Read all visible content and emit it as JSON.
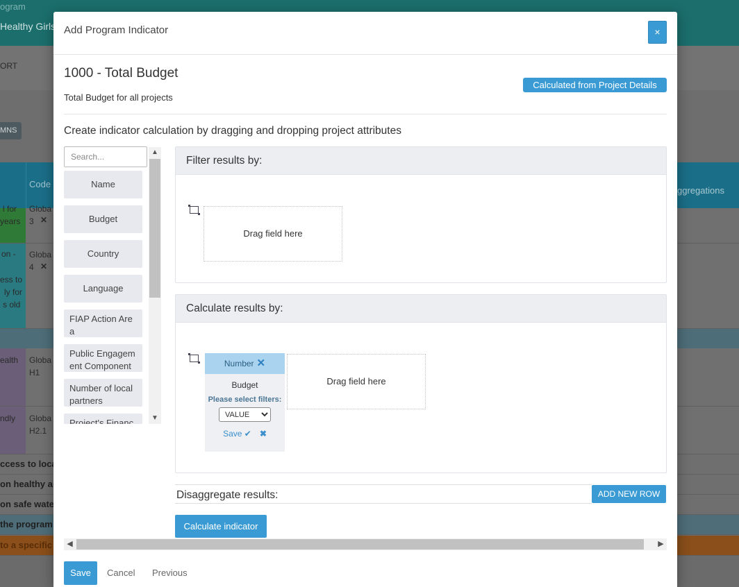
{
  "background": {
    "top_label": "ogram",
    "program_name": "Healthy Girls",
    "sub_label": "ORT",
    "columns_button": "MNS",
    "table_headers": {
      "code": "Code",
      "aggregations": "ggregations"
    },
    "rows": [
      {
        "name_lines": [
          "l for",
          "years"
        ],
        "code_lines": [
          "Globa",
          "3"
        ]
      },
      {
        "name_lines": [
          "on -",
          "",
          "ess to",
          "ly for",
          "s old"
        ],
        "code_lines": [
          "Globa",
          "4"
        ]
      },
      {
        "name_lines": [
          "ealth"
        ],
        "code_lines": [
          "Globa",
          "H1"
        ]
      },
      {
        "name_lines": [
          "ndly"
        ],
        "code_lines": [
          "Globa",
          "H2.1"
        ]
      }
    ],
    "bold_rows": [
      "ccess to loca",
      "on healthy ar",
      "on safe wate",
      "the program",
      "to a specific"
    ]
  },
  "modal": {
    "title": "Add Program Indicator",
    "close_label": "×",
    "indicator_title": "1000 - Total Budget",
    "indicator_description": "Total Budget for all projects",
    "calculated_badge": "Calculated from Project Details",
    "instructions": "Create indicator calculation by dragging and dropping project attributes",
    "search_placeholder": "Search...",
    "attributes": [
      "Name",
      "Budget",
      "Country",
      "Language",
      "FIAP Action Are a",
      "Public Engagem ent Component",
      "Number of local partners",
      "Project's Financ"
    ],
    "filter_panel": {
      "title": "Filter results by:",
      "dropzone_label": "Drag field here"
    },
    "calc_panel": {
      "title": "Calculate results by:",
      "card_type": "Number",
      "card_field": "Budget",
      "filters_prompt": "Please select filters:",
      "select_value": "VALUE",
      "save_label": "Save",
      "dropzone_label": "Drag field here"
    },
    "disaggregate_label": "Disaggregate results:",
    "add_row_label": "ADD NEW ROW",
    "calculate_button": "Calculate indicator",
    "footer": {
      "save": "Save",
      "cancel": "Cancel",
      "previous": "Previous"
    }
  },
  "colors": {
    "primary": "#3a9bd4",
    "card_header": "#a9d3ee",
    "panel_header": "#eceef2",
    "attribute_bg": "#e7e9ee"
  }
}
